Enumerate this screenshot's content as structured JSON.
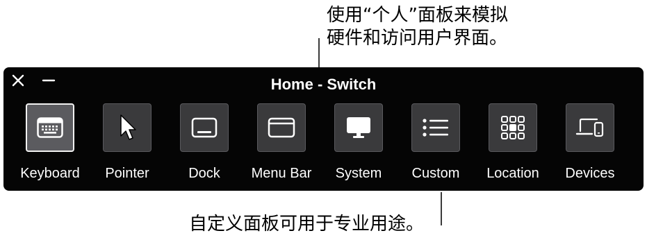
{
  "callouts": {
    "top_line1": "使用“个人”面板来模拟",
    "top_line2": "硬件和访问用户界面。",
    "bottom": "自定义面板可用于专业用途。"
  },
  "panel": {
    "title": "Home - Switch",
    "close_symbol": "close-icon",
    "minimize_symbol": "minimize-icon",
    "items": [
      {
        "label": "Keyboard",
        "icon": "keyboard-icon",
        "selected": true
      },
      {
        "label": "Pointer",
        "icon": "pointer-arrow-icon",
        "selected": false
      },
      {
        "label": "Dock",
        "icon": "dock-icon",
        "selected": false
      },
      {
        "label": "Menu Bar",
        "icon": "menu-bar-icon",
        "selected": false
      },
      {
        "label": "System",
        "icon": "display-icon",
        "selected": false
      },
      {
        "label": "Custom",
        "icon": "list-icon",
        "selected": false
      },
      {
        "label": "Location",
        "icon": "grid-icon",
        "selected": false
      },
      {
        "label": "Devices",
        "icon": "devices-icon",
        "selected": false
      }
    ]
  },
  "colors": {
    "panel_background": "#050505",
    "tile_background": "#3a3a3c",
    "tile_selected_background": "#5b5b5f",
    "text": "#ffffff"
  }
}
